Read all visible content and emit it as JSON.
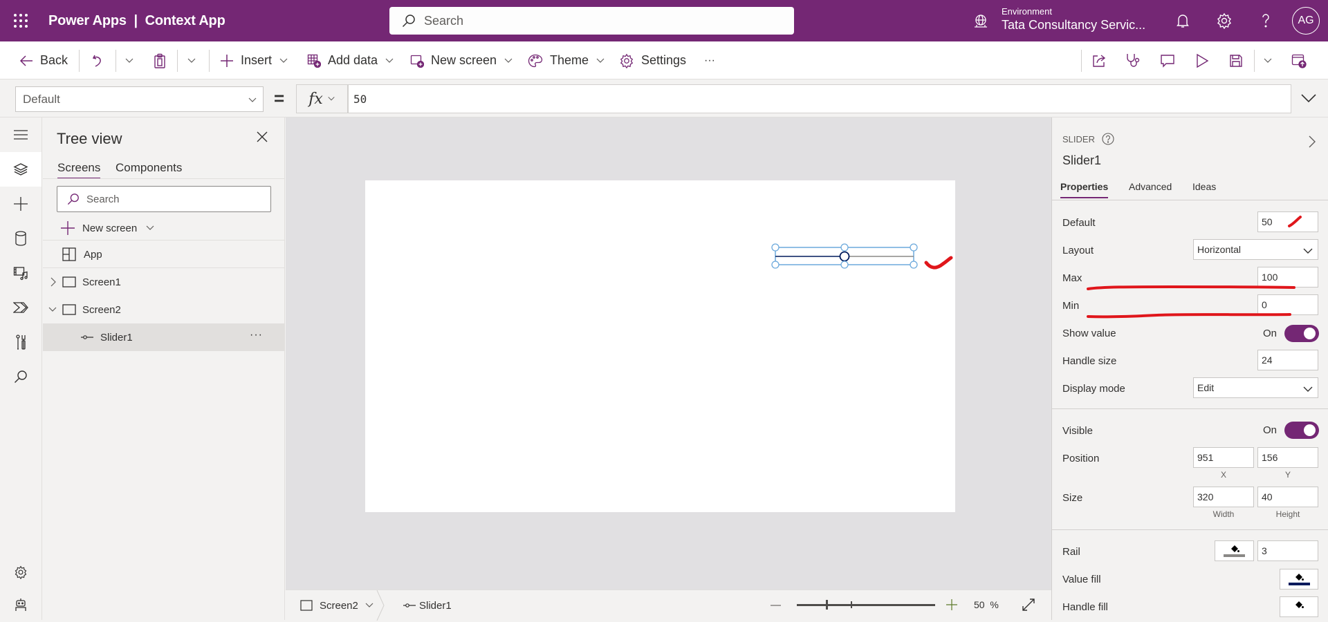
{
  "header": {
    "app_title": "Power Apps  |  Context App",
    "search_placeholder": "Search",
    "environment_label": "Environment",
    "environment_name": "Tata Consultancy Servic...",
    "avatar_initials": "AG",
    "brand_color": "#742774"
  },
  "commandbar": {
    "back": "Back",
    "insert": "Insert",
    "add_data": "Add data",
    "new_screen": "New screen",
    "theme": "Theme",
    "settings": "Settings",
    "more": "···"
  },
  "formulabar": {
    "property": "Default",
    "equals": "=",
    "fx": "fx",
    "formula": "50"
  },
  "treeview": {
    "title": "Tree view",
    "tabs": [
      {
        "label": "Screens",
        "active": true
      },
      {
        "label": "Components",
        "active": false
      }
    ],
    "search_placeholder": "Search",
    "new_screen": "New screen",
    "items": [
      {
        "label": "App",
        "type": "app"
      },
      {
        "label": "Screen1",
        "type": "screen",
        "expanded": false
      },
      {
        "label": "Screen2",
        "type": "screen",
        "expanded": true
      },
      {
        "label": "Slider1",
        "type": "slider",
        "selected": true
      }
    ],
    "more": "···"
  },
  "canvas": {
    "slider": {
      "value": 50,
      "min": 0,
      "max": 100
    }
  },
  "statusbar": {
    "screen": "Screen2",
    "control": "Slider1",
    "zoom_value": "50",
    "zoom_unit": "%",
    "zoom_percent": 50
  },
  "properties": {
    "control_type": "SLIDER",
    "control_name": "Slider1",
    "tabs": [
      {
        "label": "Properties",
        "active": true
      },
      {
        "label": "Advanced",
        "active": false
      },
      {
        "label": "Ideas",
        "active": false
      }
    ],
    "default_label": "Default",
    "default_value": "50",
    "layout_label": "Layout",
    "layout_value": "Horizontal",
    "max_label": "Max",
    "max_value": "100",
    "min_label": "Min",
    "min_value": "0",
    "show_value_label": "Show value",
    "show_value_state": "On",
    "handle_size_label": "Handle size",
    "handle_size_value": "24",
    "display_mode_label": "Display mode",
    "display_mode_value": "Edit",
    "visible_label": "Visible",
    "visible_state": "On",
    "position_label": "Position",
    "position_x": "951",
    "position_y": "156",
    "x_label": "X",
    "y_label": "Y",
    "size_label": "Size",
    "size_width": "320",
    "size_height": "40",
    "width_label": "Width",
    "height_label": "Height",
    "rail_label": "Rail",
    "rail_thickness": "3",
    "rail_color": "#8a8886",
    "value_fill_label": "Value fill",
    "value_fill_color": "#001a5c",
    "handle_fill_label": "Handle fill",
    "handle_fill_color": "#ffffff"
  }
}
